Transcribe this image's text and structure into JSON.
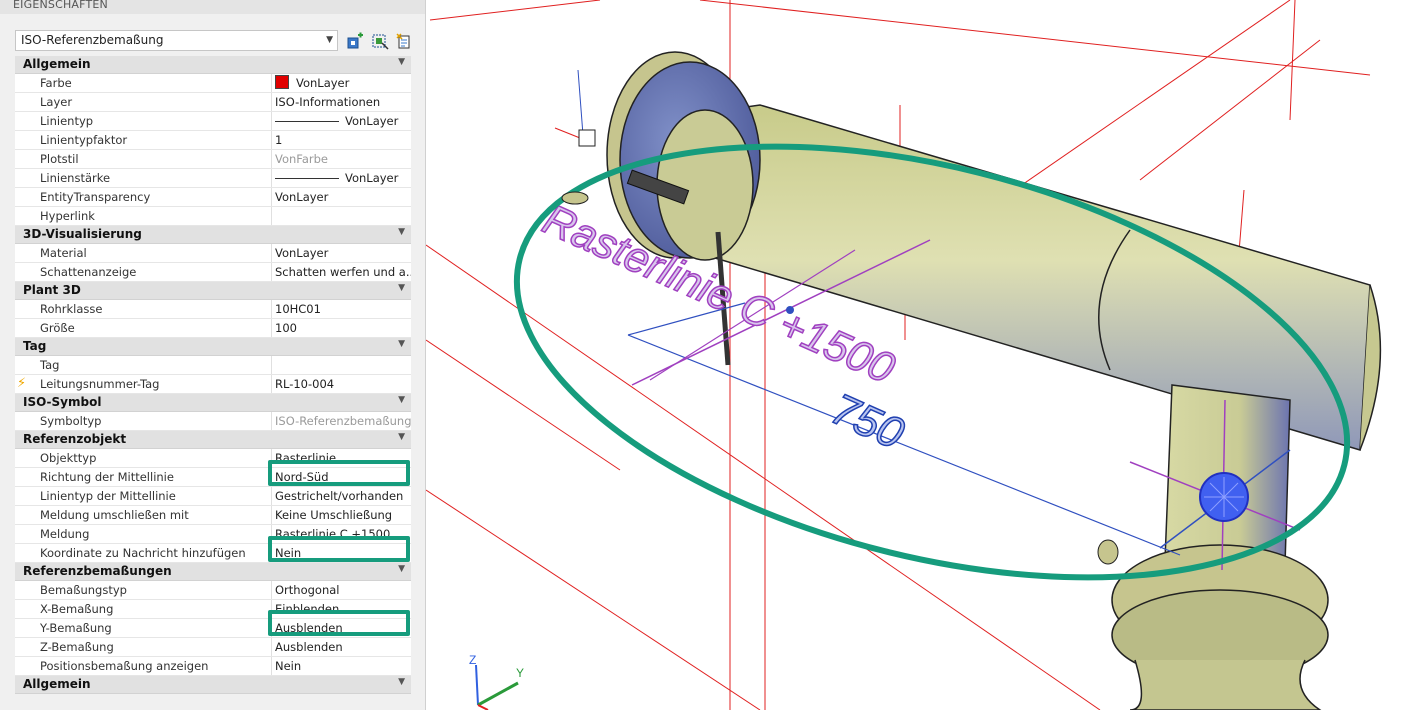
{
  "palette": {
    "title": "EIGENSCHAFTEN",
    "object_type": "ISO-Referenzbemaßung",
    "toolbar_icons": [
      "quick-select-icon",
      "select-objects-icon",
      "toggle-pickadd-icon"
    ]
  },
  "categories": [
    {
      "label": "Allgemein",
      "rows": [
        {
          "label": "Farbe",
          "value": "VonLayer",
          "swatch": "#e00000"
        },
        {
          "label": "Layer",
          "value": "ISO-Informationen"
        },
        {
          "label": "Linientyp",
          "value": "VonLayer",
          "line": true
        },
        {
          "label": "Linientypfaktor",
          "value": "1"
        },
        {
          "label": "Plotstil",
          "value": "VonFarbe",
          "disabled": true
        },
        {
          "label": "Linienstärke",
          "value": "VonLayer",
          "line": true
        },
        {
          "label": "EntityTransparency",
          "value": "VonLayer"
        },
        {
          "label": "Hyperlink",
          "value": ""
        }
      ]
    },
    {
      "label": "3D-Visualisierung",
      "rows": [
        {
          "label": "Material",
          "value": "VonLayer"
        },
        {
          "label": "Schattenanzeige",
          "value": "Schatten werfen und a..."
        }
      ]
    },
    {
      "label": "Plant 3D",
      "rows": [
        {
          "label": "Rohrklasse",
          "value": "10HC01"
        },
        {
          "label": "Größe",
          "value": "100"
        }
      ]
    },
    {
      "label": "Tag",
      "rows": [
        {
          "label": "Tag",
          "value": ""
        },
        {
          "label": "Leitungsnummer-Tag",
          "value": "RL-10-004",
          "bolt": true
        }
      ]
    },
    {
      "label": "ISO-Symbol",
      "rows": [
        {
          "label": "Symboltyp",
          "value": "ISO-Referenzbemaßung",
          "disabled": true
        }
      ]
    },
    {
      "label": "Referenzobjekt",
      "rows": [
        {
          "label": "Objekttyp",
          "value": "Rasterlinie"
        },
        {
          "label": "Richtung der Mittellinie",
          "value": "Nord-Süd"
        },
        {
          "label": "Linientyp der Mittellinie",
          "value": "Gestrichelt/vorhanden"
        },
        {
          "label": "Meldung umschließen mit",
          "value": "Keine Umschließung"
        },
        {
          "label": "Meldung",
          "value": "Rasterlinie C +1500"
        },
        {
          "label": "Koordinate zu Nachricht hinzufügen",
          "value": "Nein"
        }
      ]
    },
    {
      "label": "Referenzbemaßungen",
      "rows": [
        {
          "label": "Bemaßungstyp",
          "value": "Orthogonal"
        },
        {
          "label": "X-Bemaßung",
          "value": "Einblenden"
        },
        {
          "label": "Y-Bemaßung",
          "value": "Ausblenden"
        },
        {
          "label": "Z-Bemaßung",
          "value": "Ausblenden"
        },
        {
          "label": "Positionsbemaßung anzeigen",
          "value": "Nein"
        }
      ]
    },
    {
      "label": "Allgemein",
      "rows": []
    }
  ],
  "highlights": [
    "Objekttyp",
    "Meldung",
    "X-Bemaßung"
  ],
  "viewport": {
    "grid_label": "Rasterlinie C +1500",
    "dimension_value": "750",
    "ucs_axes": [
      "Z",
      "Y"
    ],
    "colors": {
      "pipe": "#d4d6a0",
      "grid": "#e02020",
      "annotation": "#a040c0",
      "dimension": "#3050c0",
      "highlight": "#169c7d"
    }
  }
}
